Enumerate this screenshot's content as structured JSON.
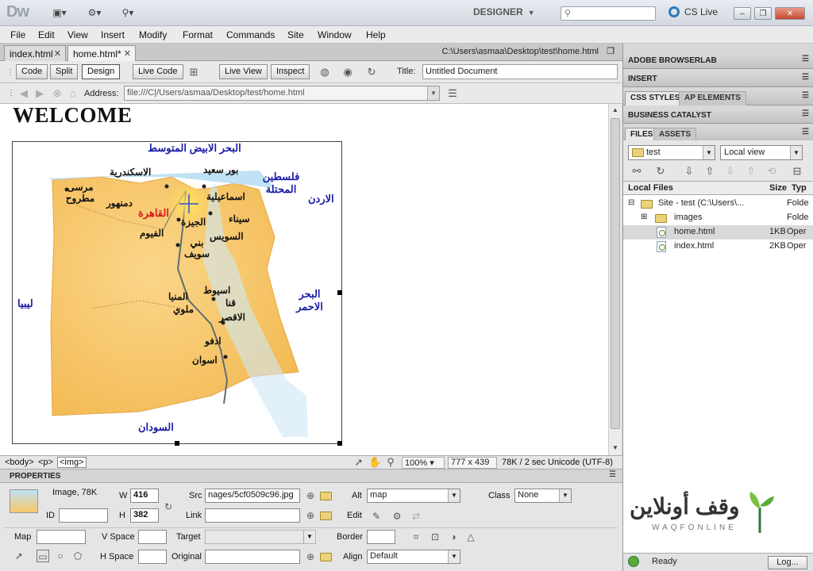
{
  "app": {
    "logo": "Dw",
    "workspace": "DESIGNER",
    "search_placeholder": "",
    "cs_live": "CS Live"
  },
  "menu": [
    "File",
    "Edit",
    "View",
    "Insert",
    "Modify",
    "Format",
    "Commands",
    "Site",
    "Window",
    "Help"
  ],
  "doc_tabs": [
    {
      "label": "index.html"
    },
    {
      "label": "home.html*",
      "active": true
    }
  ],
  "doc_path": "C:\\Users\\asmaa\\Desktop\\test\\home.html",
  "doc_toolbar": {
    "code": "Code",
    "split": "Split",
    "design": "Design",
    "live_code": "Live Code",
    "live_view": "Live View",
    "inspect": "Inspect",
    "title_label": "Title:",
    "title_value": "Untitled Document"
  },
  "browser_nav": {
    "address_label": "Address:",
    "address_value": "file:///C|/Users/asmaa/Desktop/test/home.html"
  },
  "document": {
    "heading": "WELCOME",
    "map_labels": {
      "mediterranean": "البحر الابيض المتوسط",
      "alexandria": "الاسكندرية",
      "port_said": "بور سعيد",
      "palestine": "فلسطين المحتلة",
      "jordan": "الاردن",
      "marsa_matruh": "مرسى مطروح",
      "damanhur": "دمنهور",
      "cairo": "القاهرة",
      "ismailia": "اسماعيلية",
      "sinai": "سيناء",
      "giza": "الجيزة",
      "fayoum": "الفيوم",
      "suez": "السويس",
      "beni_suef": "بني سويف",
      "libya": "ليبيا",
      "red_sea": "البحر الاحمر",
      "assiut": "اسيوط",
      "minya": "المنيا",
      "mallawi": "ملوي",
      "qena": "قنا",
      "luxor": "الاقصر",
      "edfu": "ادفو",
      "aswan": "اسوان",
      "sudan": "السودان"
    }
  },
  "statusbar": {
    "tags": [
      "<body>",
      "<p>",
      "<img>"
    ],
    "zoom": "100%",
    "window_size": "777 x 439",
    "download": "78K / 2 sec",
    "encoding": "Unicode (UTF-8)"
  },
  "properties": {
    "title": "PROPERTIES",
    "image_info": "Image, 78K",
    "w_label": "W",
    "w_value": "416",
    "h_label": "H",
    "h_value": "382",
    "id_label": "ID",
    "src_label": "Src",
    "src_value": "nages/5cf0509c96.jpg",
    "link_label": "Link",
    "alt_label": "Alt",
    "alt_value": "map",
    "edit_label": "Edit",
    "class_label": "Class",
    "class_value": "None",
    "map_label": "Map",
    "vspace_label": "V Space",
    "target_label": "Target",
    "border_label": "Border",
    "hspace_label": "H Space",
    "original_label": "Original",
    "align_label": "Align",
    "align_value": "Default"
  },
  "panels": {
    "browserlab": "ADOBE BROWSERLAB",
    "insert": "INSERT",
    "css_styles": "CSS STYLES",
    "ap_elements": "AP ELEMENTS",
    "business_catalyst": "BUSINESS CATALYST",
    "files_tab": "FILES",
    "assets_tab": "ASSETS",
    "site_select": "test",
    "view_select": "Local view",
    "col_local": "Local Files",
    "col_size": "Size",
    "col_type": "Typ",
    "tree": [
      {
        "name": "Site - test (C:\\Users\\...",
        "size": "",
        "type": "Folde"
      },
      {
        "name": "images",
        "size": "",
        "type": "Folde"
      },
      {
        "name": "home.html",
        "size": "1KB",
        "type": "Oper"
      },
      {
        "name": "index.html",
        "size": "2KB",
        "type": "Oper"
      }
    ],
    "status": "Ready",
    "log_button": "Log..."
  },
  "watermark": {
    "arabic": "وقف أونلاين",
    "english": "WAQFONLINE"
  }
}
